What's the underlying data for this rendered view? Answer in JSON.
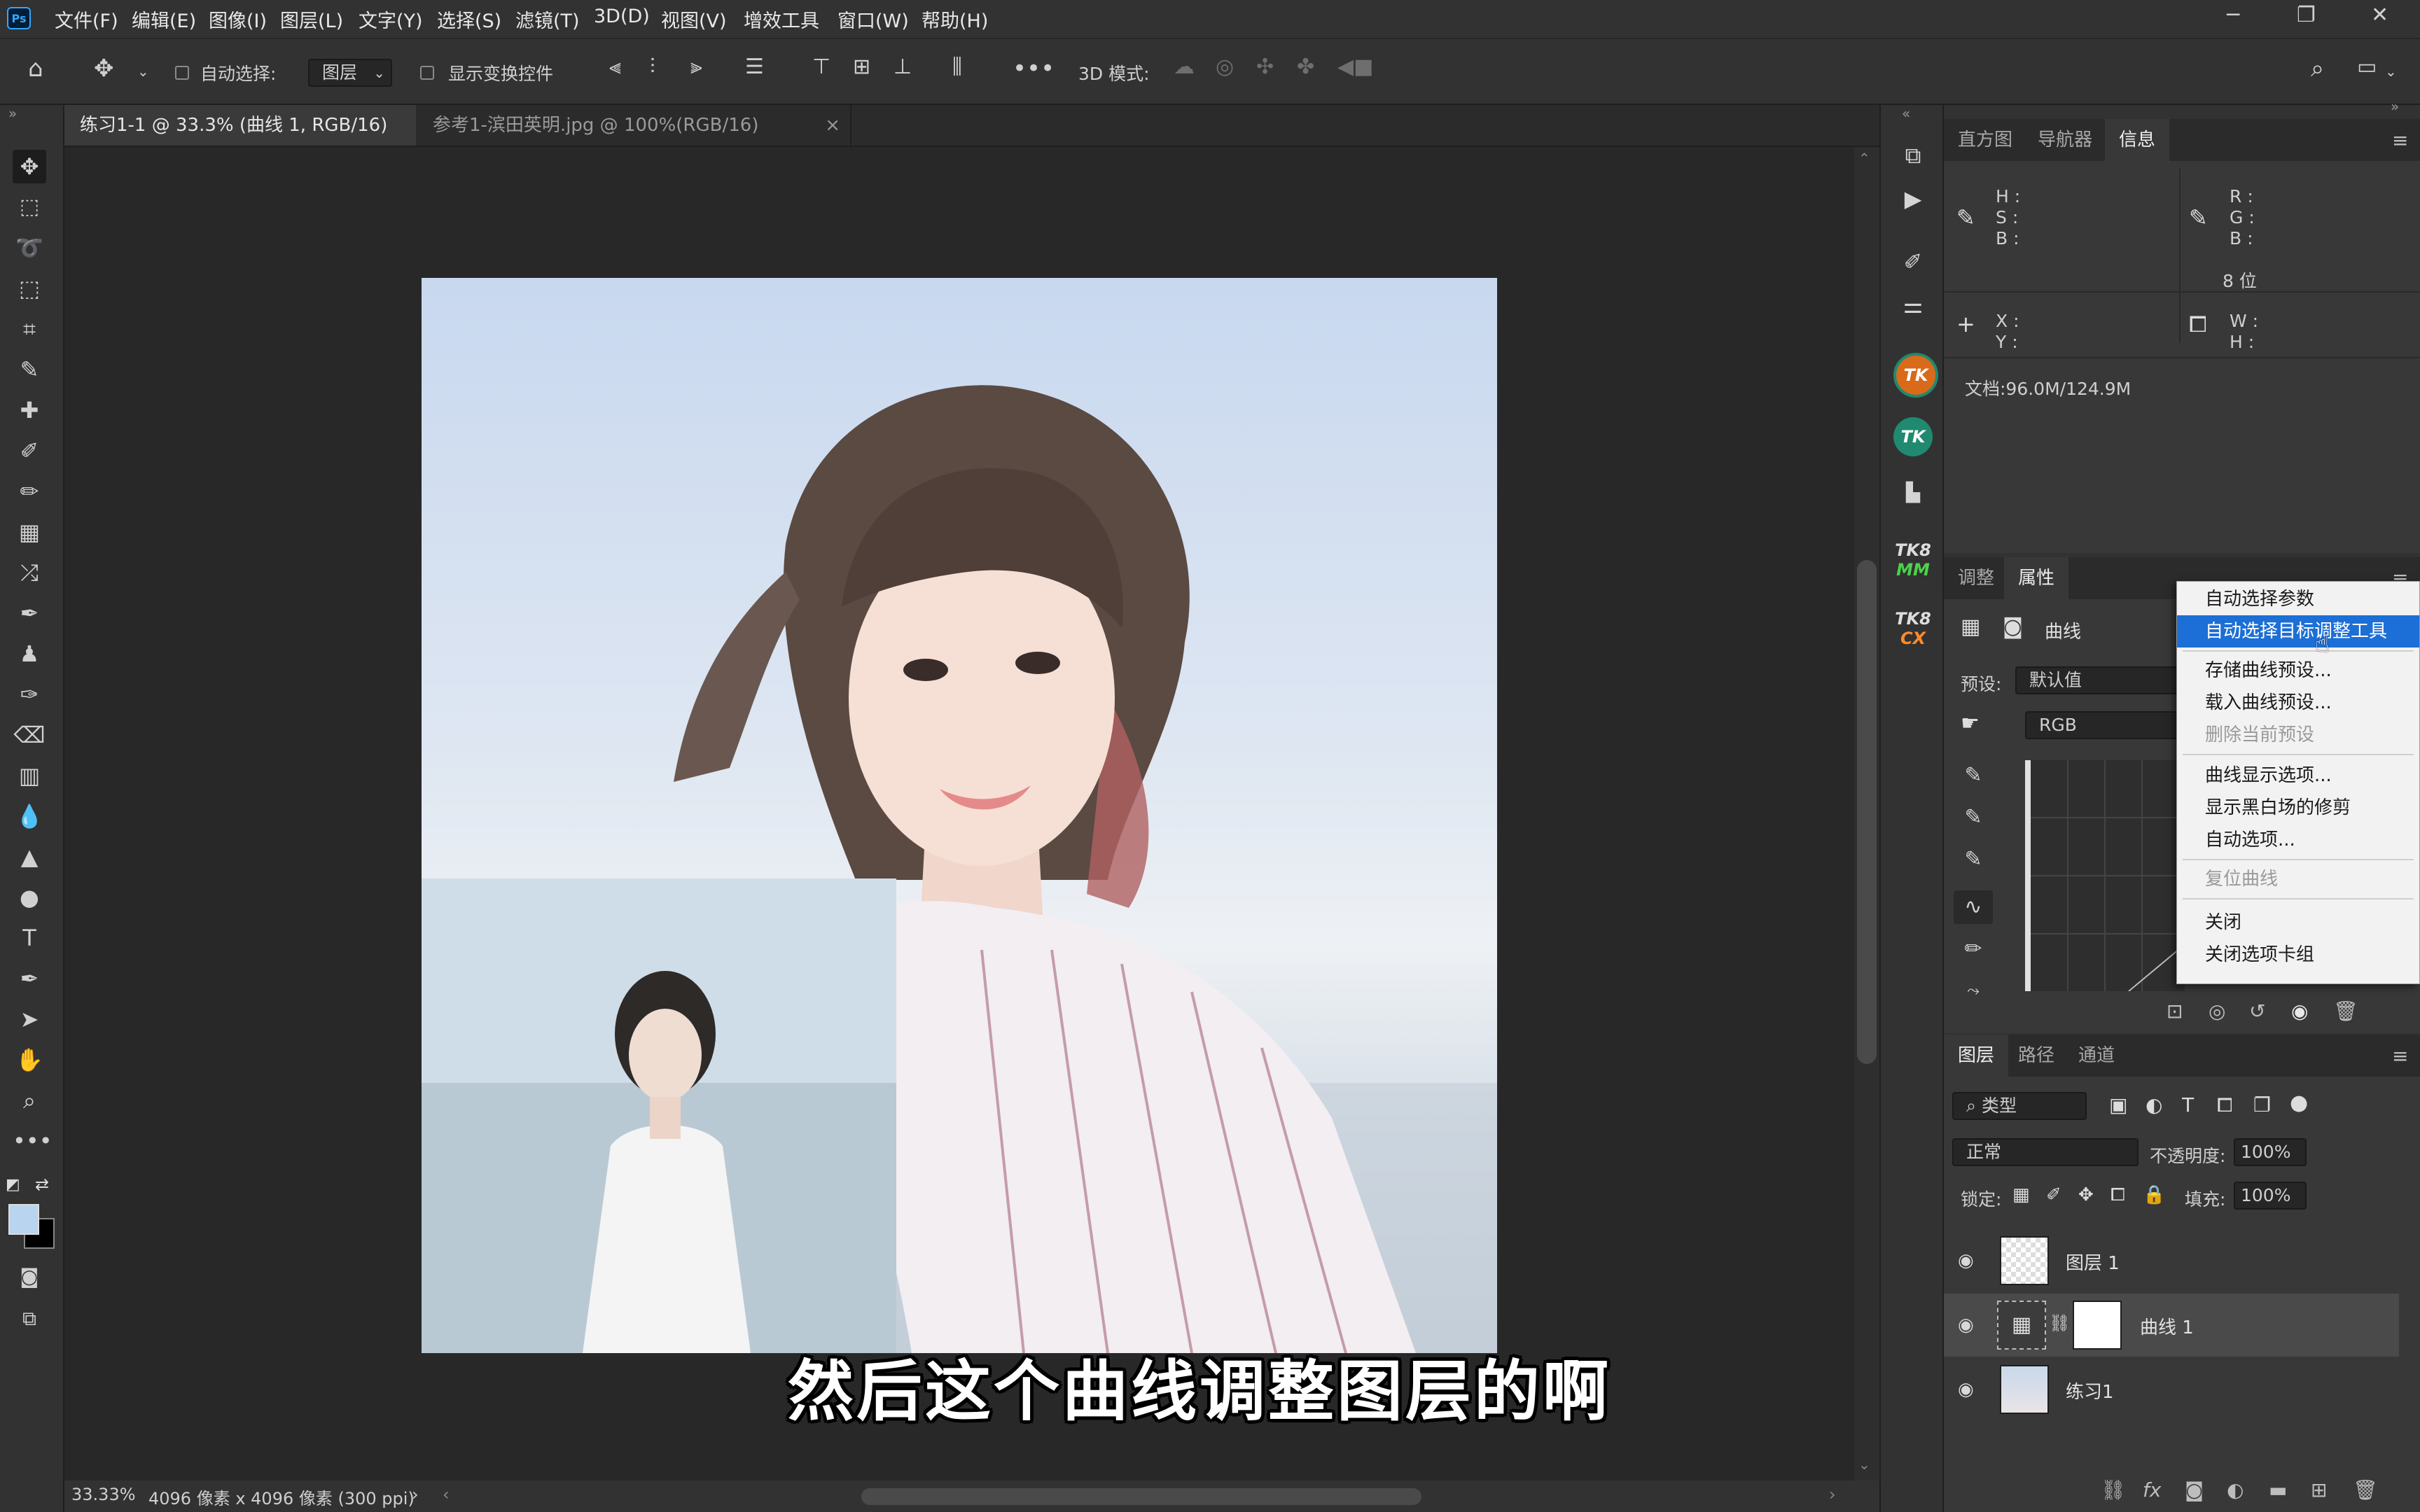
{
  "app": {
    "logo": "Ps"
  },
  "menu": [
    "文件(F)",
    "编辑(E)",
    "图像(I)",
    "图层(L)",
    "文字(Y)",
    "选择(S)",
    "滤镜(T)",
    "3D(D)",
    "视图(V)",
    "增效工具",
    "窗口(W)",
    "帮助(H)"
  ],
  "options": {
    "auto_select_label": "自动选择:",
    "auto_select_target": "图层",
    "show_transform_label": "显示变换控件",
    "mode3d_label": "3D 模式:"
  },
  "tabs": [
    {
      "label": "练习1-1 @ 33.3% (曲线 1, RGB/16) *",
      "close": "×"
    },
    {
      "label": "参考1-滨田英明.jpg @ 100%(RGB/16)",
      "close": "×"
    }
  ],
  "status": {
    "zoom": "33.33%",
    "doc_info": "4096 像素 x 4096 像素 (300 ppi)",
    "arrow": "›"
  },
  "subtitle": "然后这个曲线调整图层的啊",
  "info_panel": {
    "tabs": [
      "直方图",
      "导航器",
      "信息"
    ],
    "left_labels": [
      "H :",
      "S :",
      "B :"
    ],
    "right_labels": [
      "R :",
      "G :",
      "B :"
    ],
    "bits": "8 位",
    "xy_labels": [
      "X :",
      "Y :"
    ],
    "wh_labels": [
      "W :",
      "H :"
    ],
    "doc": "文档:96.0M/124.9M"
  },
  "props_panel": {
    "tabs": [
      "调整",
      "属性"
    ],
    "title": "曲线",
    "preset_label": "预设:",
    "preset_value": "默认值",
    "channel": "RGB"
  },
  "context_menu": {
    "items": [
      {
        "label": "自动选择参数",
        "state": "normal"
      },
      {
        "label": "自动选择目标调整工具",
        "state": "highlighted"
      },
      {
        "label": "存储曲线预设...",
        "state": "normal"
      },
      {
        "label": "载入曲线预设...",
        "state": "normal"
      },
      {
        "label": "删除当前预设",
        "state": "disabled"
      },
      {
        "label": "曲线显示选项...",
        "state": "normal"
      },
      {
        "label": "显示黑白场的修剪",
        "state": "normal"
      },
      {
        "label": "自动选项...",
        "state": "normal"
      },
      {
        "label": "复位曲线",
        "state": "disabled"
      },
      {
        "label": "关闭",
        "state": "normal"
      },
      {
        "label": "关闭选项卡组",
        "state": "normal"
      }
    ]
  },
  "layers_panel": {
    "tabs": [
      "图层",
      "路径",
      "通道"
    ],
    "filter_label": "类型",
    "blend_mode": "正常",
    "opacity_label": "不透明度:",
    "opacity_value": "100%",
    "lock_label": "锁定:",
    "fill_label": "填充:",
    "fill_value": "100%",
    "layers": [
      {
        "name": "图层 1",
        "selected": false
      },
      {
        "name": "曲线 1",
        "selected": true
      },
      {
        "name": "练习1",
        "selected": false
      }
    ],
    "bottom_icons": [
      "link-icon",
      "fx-icon",
      "mask-icon",
      "adjustment-icon",
      "folder-icon",
      "new-layer-icon",
      "trash-icon"
    ],
    "fx_label": "fx"
  },
  "dock": {
    "tk_label": "TK",
    "tk8mm": [
      "TK8",
      "MM"
    ],
    "tk8cx": [
      "TK8",
      "CX"
    ]
  },
  "colors": {
    "accent": "#1c6fd6",
    "fg_swatch": "#b8d4ee",
    "bg_swatch": "#000000",
    "tk_green": "#1f8a6f"
  }
}
